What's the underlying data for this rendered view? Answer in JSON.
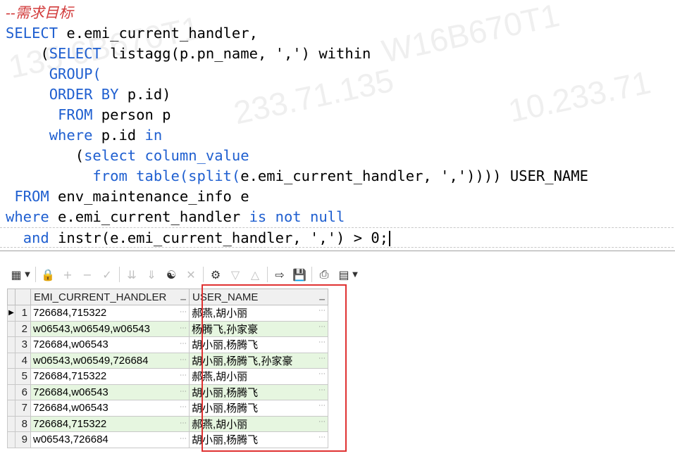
{
  "editor": {
    "comment": "--需求目标",
    "lines": [
      [
        {
          "t": "SELECT",
          "k": 1
        },
        {
          "t": " e.emi_current_handler,"
        }
      ],
      [
        {
          "t": "    ("
        },
        {
          "t": "SELECT",
          "k": 1
        },
        {
          "t": " listagg(p.pn_name, ',') within"
        }
      ],
      [
        {
          "t": "     "
        },
        {
          "t": "GROUP(",
          "k": 1
        }
      ],
      [
        {
          "t": "     "
        },
        {
          "t": "ORDER BY",
          "k": 1
        },
        {
          "t": " p.id)"
        }
      ],
      [
        {
          "t": "      "
        },
        {
          "t": "FROM",
          "k": 1
        },
        {
          "t": " person p"
        }
      ],
      [
        {
          "t": "     "
        },
        {
          "t": "where",
          "k": 1
        },
        {
          "t": " p.id "
        },
        {
          "t": "in",
          "k": 1
        }
      ],
      [
        {
          "t": "        ("
        },
        {
          "t": "select column_value",
          "k": 1
        }
      ],
      [
        {
          "t": "          "
        },
        {
          "t": "from table(split(",
          "k": 1
        },
        {
          "t": "e.emi_current_handler, ','))))"
        },
        {
          "t": " USER_NAME"
        }
      ],
      [
        {
          "t": " "
        },
        {
          "t": "FROM",
          "k": 1
        },
        {
          "t": " env_maintenance_info e"
        }
      ],
      [
        {
          "t": ""
        },
        {
          "t": "where",
          "k": 1
        },
        {
          "t": " e.emi_current_handler "
        },
        {
          "t": "is not null",
          "k": 1
        }
      ],
      [
        {
          "t": "  "
        },
        {
          "t": "and",
          "k": 1
        },
        {
          "t": " instr(e.emi_current_handler, ',') > 0;"
        }
      ]
    ]
  },
  "toolbar": {
    "icons": [
      "grid-layout-icon",
      "dropdown-arrow-icon",
      "lock-icon",
      "add-record-icon",
      "delete-record-icon",
      "post-changes-icon",
      "filter-icon",
      "clear-filter-icon",
      "find-icon",
      "clear-icon",
      "query-by-example-icon",
      "next-record-icon",
      "previous-record-icon",
      "export-icon",
      "save-icon",
      "print-icon",
      "chart-icon",
      "dropdown-arrow-icon"
    ]
  },
  "grid": {
    "columns": [
      "EMI_CURRENT_HANDLER",
      "USER_NAME"
    ],
    "rows": [
      {
        "n": "1",
        "handler": "726684,715322",
        "user": "郝燕,胡小丽"
      },
      {
        "n": "2",
        "handler": "w06543,w06549,w06543",
        "user": "杨腾飞,孙家豪"
      },
      {
        "n": "3",
        "handler": "726684,w06543",
        "user": "胡小丽,杨腾飞"
      },
      {
        "n": "4",
        "handler": "w06543,w06549,726684",
        "user": "胡小丽,杨腾飞,孙家豪"
      },
      {
        "n": "5",
        "handler": "726684,715322",
        "user": "郝燕,胡小丽"
      },
      {
        "n": "6",
        "handler": "726684,w06543",
        "user": "胡小丽,杨腾飞"
      },
      {
        "n": "7",
        "handler": "726684,w06543",
        "user": "胡小丽,杨腾飞"
      },
      {
        "n": "8",
        "handler": "726684,715322",
        "user": "郝燕,胡小丽"
      },
      {
        "n": "9",
        "handler": "w06543,726684",
        "user": "胡小丽,杨腾飞"
      }
    ]
  }
}
